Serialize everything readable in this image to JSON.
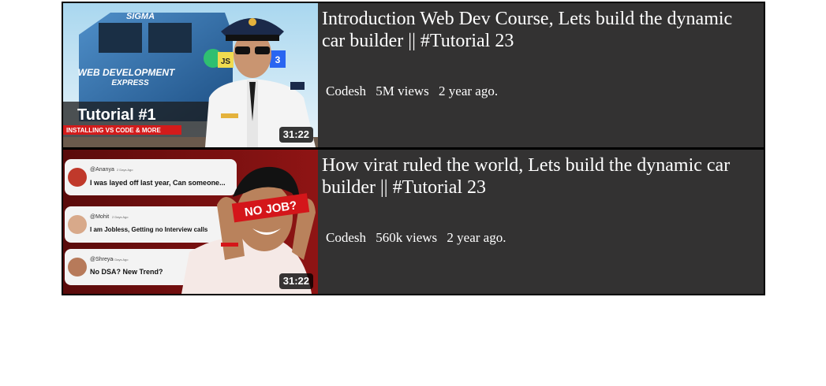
{
  "videos": [
    {
      "title": "Introduction Web Dev Course, Lets build the dynamic car builder || #Tutorial 23",
      "channel": "Codesh",
      "views": "5M views",
      "age": "2 year ago.",
      "duration": "31:22",
      "thumbnail": {
        "brand_text": "SIGMA",
        "banner_line1": "WEB DEVELOPMENT",
        "banner_line2": "EXPRESS",
        "heading": "Tutorial #1",
        "subheading": "INSTALLING VS CODE & MORE",
        "icon_js": "JS",
        "icon_css": "3"
      }
    },
    {
      "title": "How virat ruled the world, Lets build the dynamic car builder || #Tutorial 23",
      "channel": "Codesh",
      "views": "560k views",
      "age": "2 year ago.",
      "duration": "31:22",
      "thumbnail": {
        "overlay_text": "NO JOB?",
        "comments": [
          {
            "user": "@Ananya",
            "time": "2 Days Ago",
            "text": "I was layed off last year, Can someone..."
          },
          {
            "user": "@Mohit",
            "time": "2 Days Ago",
            "text": "I am Jobless, Getting no Interview calls"
          },
          {
            "user": "@Shreya",
            "time": "2 Days Ago",
            "text": "No DSA? New Trend?"
          }
        ]
      }
    }
  ],
  "colors": {
    "row_bg": "#333232",
    "border": "#000000",
    "text": "#ffffff"
  }
}
